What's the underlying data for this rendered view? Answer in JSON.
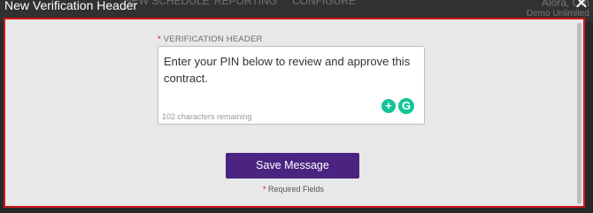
{
  "background": {
    "nav_items": [
      "NEW SCHEDULE",
      "REPORTING",
      "CONFIGURE"
    ],
    "user_name": "Alora, Om",
    "user_org": "Demo Unlimited"
  },
  "modal": {
    "title": "New Verification Header",
    "close_icon": "close-icon",
    "field_label": "VERIFICATION HEADER",
    "required_marker": "*",
    "textarea_value": "Enter your PIN below to review and approve this contract.",
    "char_remaining": "102 characters remaining",
    "save_label": "Save Message",
    "required_fields_text": "Required Fields"
  },
  "colors": {
    "accent": "#4b2481",
    "required": "#d3141b",
    "grammarly": "#15c39a"
  }
}
